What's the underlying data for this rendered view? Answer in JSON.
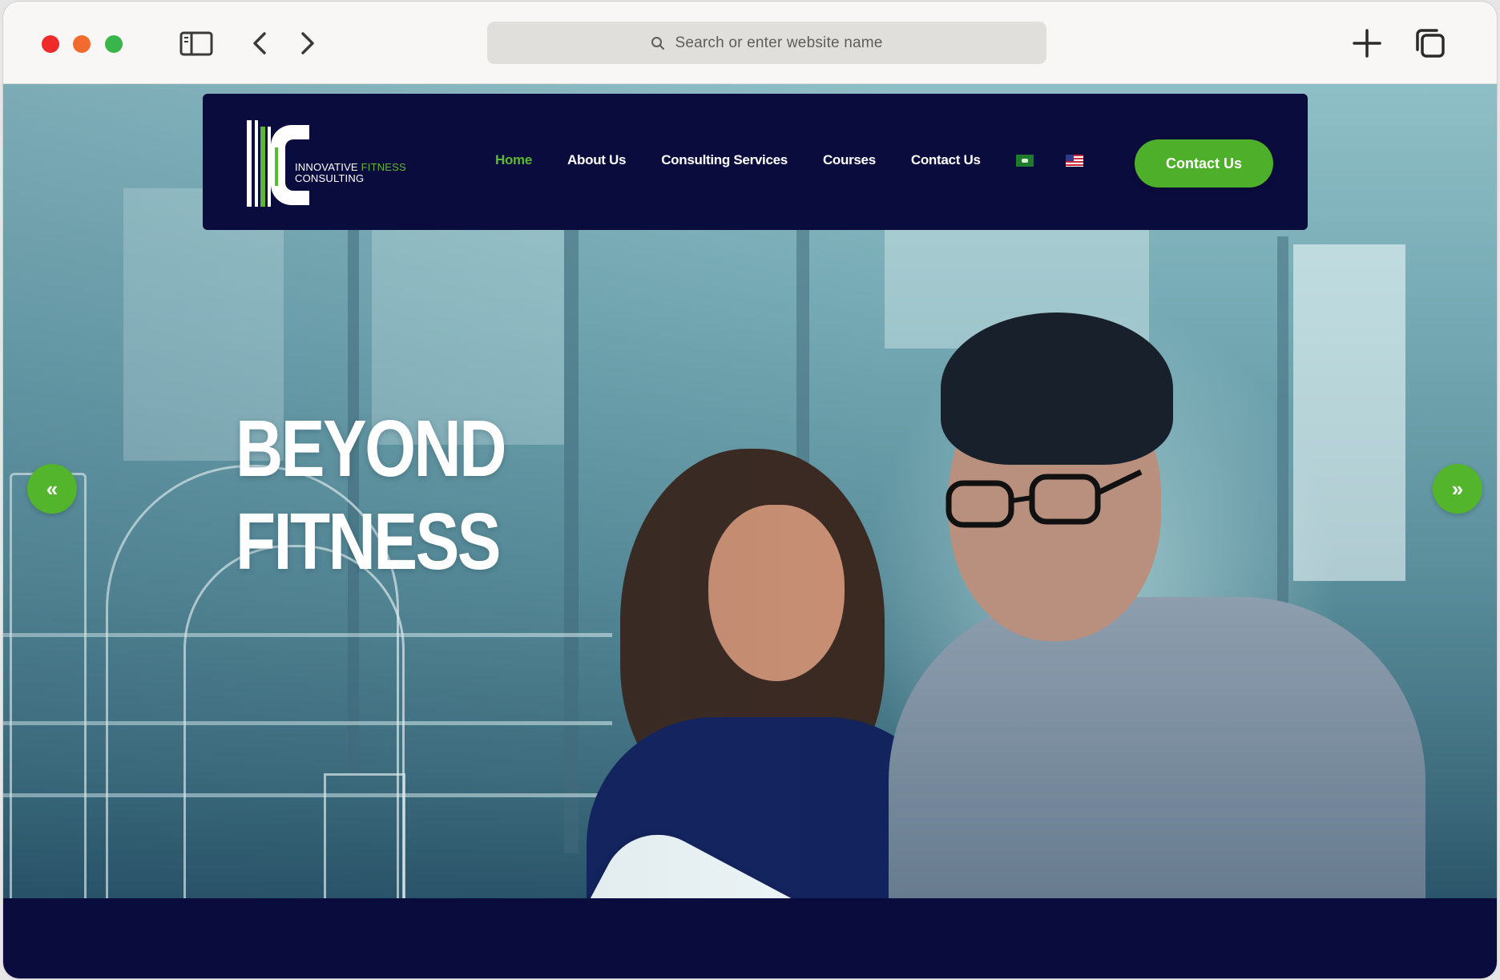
{
  "browser": {
    "address_placeholder": "Search or enter website name",
    "traffic_lights": [
      "#ee2b2b",
      "#f36a2e",
      "#39b54a"
    ]
  },
  "site": {
    "logo": {
      "monogram": "IFC",
      "line1_part1": "INNOVATIVE ",
      "line1_part2": "FITNESS",
      "line2": "CONSULTING"
    },
    "nav": {
      "items": [
        {
          "label": "Home",
          "active": true
        },
        {
          "label": "About Us",
          "active": false
        },
        {
          "label": "Consulting Services",
          "active": false
        },
        {
          "label": "Courses",
          "active": false
        },
        {
          "label": "Contact Us",
          "active": false
        }
      ],
      "languages": [
        "arabic-flag-icon",
        "us-flag-icon"
      ]
    },
    "header_cta": "Contact Us",
    "hero": {
      "title_line1": "BEYOND",
      "title_line2": "FITNESS",
      "prev_arrow": "«",
      "next_arrow": "»"
    },
    "colors": {
      "navy": "#0b0c3e",
      "green": "#4eb02a"
    }
  }
}
